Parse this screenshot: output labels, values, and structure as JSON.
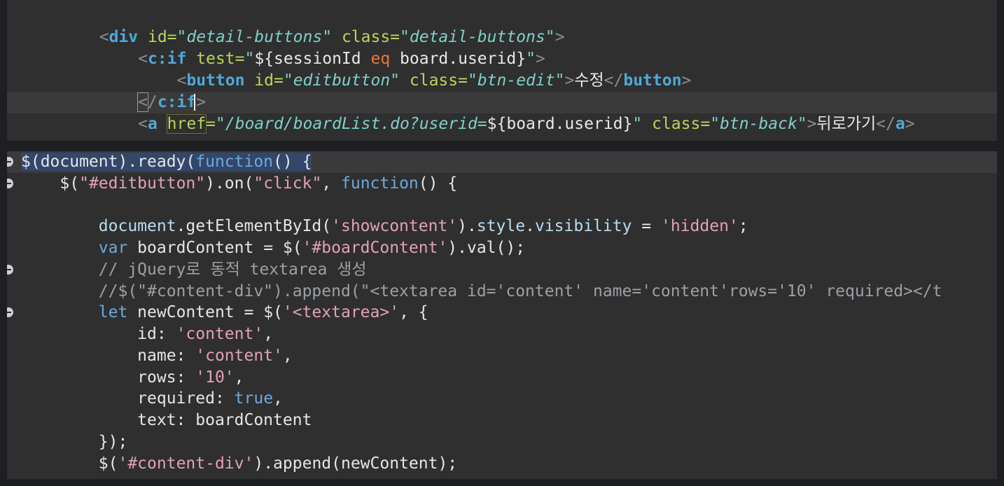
{
  "html_editor": {
    "lines": [
      [
        {
          "c": "plain",
          "t": "  "
        },
        {
          "c": "tag-punct",
          "t": "<"
        },
        {
          "c": "tag-name",
          "t": "div"
        },
        {
          "c": "plain",
          "t": " "
        },
        {
          "c": "attr-name",
          "t": "id="
        },
        {
          "c": "attr-val",
          "t": "\"detail-buttons\""
        },
        {
          "c": "plain",
          "t": " "
        },
        {
          "c": "attr-name",
          "t": "class="
        },
        {
          "c": "attr-val",
          "t": "\"detail-buttons\""
        },
        {
          "c": "tag-punct",
          "t": ">"
        }
      ],
      [
        {
          "c": "plain",
          "t": "      "
        },
        {
          "c": "tag-punct",
          "t": "<"
        },
        {
          "c": "tag-name",
          "t": "c:if"
        },
        {
          "c": "plain",
          "t": " "
        },
        {
          "c": "attr-name",
          "t": "test="
        },
        {
          "c": "attr-val",
          "t": "\""
        },
        {
          "c": "el-expr",
          "t": "${sessionId "
        },
        {
          "c": "el-op",
          "t": "eq"
        },
        {
          "c": "el-expr",
          "t": " board.userid}"
        },
        {
          "c": "attr-val",
          "t": "\""
        },
        {
          "c": "tag-punct",
          "t": ">"
        }
      ],
      [
        {
          "c": "plain",
          "t": "          "
        },
        {
          "c": "tag-punct",
          "t": "<"
        },
        {
          "c": "tag-name",
          "t": "button"
        },
        {
          "c": "plain",
          "t": " "
        },
        {
          "c": "attr-name",
          "t": "id="
        },
        {
          "c": "attr-val",
          "t": "\"editbutton\""
        },
        {
          "c": "plain",
          "t": " "
        },
        {
          "c": "attr-name",
          "t": "class="
        },
        {
          "c": "attr-val",
          "t": "\"btn-edit\""
        },
        {
          "c": "tag-punct",
          "t": ">"
        },
        {
          "c": "plain",
          "t": "수정"
        },
        {
          "c": "tag-punct",
          "t": "</"
        },
        {
          "c": "tag-name",
          "t": "button"
        },
        {
          "c": "tag-punct",
          "t": ">"
        }
      ],
      [
        {
          "c": "plain",
          "t": "      "
        },
        {
          "c": "tag-punct bracket-box",
          "t": "<"
        },
        {
          "c": "tag-punct",
          "t": "/"
        },
        {
          "c": "tag-name",
          "t": "c:if"
        },
        {
          "c": "tag-punct",
          "t": ">"
        }
      ],
      [
        {
          "c": "plain",
          "t": "      "
        },
        {
          "c": "tag-punct",
          "t": "<"
        },
        {
          "c": "tag-name",
          "t": "a"
        },
        {
          "c": "plain",
          "t": " "
        },
        {
          "c": "attr-name href-box",
          "t": "href"
        },
        {
          "c": "attr-name",
          "t": "="
        },
        {
          "c": "attr-val",
          "t": "\"/board/boardList.do?userid="
        },
        {
          "c": "el-expr",
          "t": "${board.userid}"
        },
        {
          "c": "attr-val",
          "t": "\""
        },
        {
          "c": "plain",
          "t": " "
        },
        {
          "c": "attr-name",
          "t": "class="
        },
        {
          "c": "attr-val",
          "t": "\"btn-back\""
        },
        {
          "c": "tag-punct",
          "t": ">"
        },
        {
          "c": "plain",
          "t": "뒤로가기"
        },
        {
          "c": "tag-punct",
          "t": "</"
        },
        {
          "c": "tag-name",
          "t": "a"
        },
        {
          "c": "tag-punct",
          "t": ">"
        }
      ]
    ]
  },
  "js_editor": {
    "lines": [
      [
        {
          "c": "fn sel",
          "t": "$(document).ready("
        },
        {
          "c": "kw sel",
          "t": "function"
        },
        {
          "c": "fn sel",
          "t": "() {"
        }
      ],
      [
        {
          "c": "plain",
          "t": "    "
        },
        {
          "c": "fn",
          "t": "$("
        },
        {
          "c": "str",
          "t": "\"#editbutton\""
        },
        {
          "c": "fn",
          "t": ").on("
        },
        {
          "c": "str",
          "t": "\"click\""
        },
        {
          "c": "fn",
          "t": ", "
        },
        {
          "c": "kw",
          "t": "function"
        },
        {
          "c": "fn",
          "t": "() {"
        }
      ],
      [],
      [
        {
          "c": "plain",
          "t": "        "
        },
        {
          "c": "prop",
          "t": "document"
        },
        {
          "c": "fn",
          "t": ".getElementById("
        },
        {
          "c": "str",
          "t": "'showcontent'"
        },
        {
          "c": "fn",
          "t": ")."
        },
        {
          "c": "prop",
          "t": "style"
        },
        {
          "c": "fn",
          "t": "."
        },
        {
          "c": "prop",
          "t": "visibility"
        },
        {
          "c": "fn",
          "t": " = "
        },
        {
          "c": "str",
          "t": "'hidden'"
        },
        {
          "c": "fn",
          "t": ";"
        }
      ],
      [
        {
          "c": "plain",
          "t": "        "
        },
        {
          "c": "kw",
          "t": "var"
        },
        {
          "c": "fn",
          "t": " boardContent = $("
        },
        {
          "c": "str",
          "t": "'#boardContent'"
        },
        {
          "c": "fn",
          "t": ").val();"
        }
      ],
      [
        {
          "c": "plain",
          "t": "        "
        },
        {
          "c": "cmt",
          "t": "// jQuery로 동적 textarea 생성"
        }
      ],
      [
        {
          "c": "plain",
          "t": "        "
        },
        {
          "c": "cmt",
          "t": "//$(\"#content-div\").append(\"<textarea id='content' name='content'rows='10' required></t"
        }
      ],
      [
        {
          "c": "plain",
          "t": "        "
        },
        {
          "c": "kw",
          "t": "let"
        },
        {
          "c": "fn",
          "t": " newContent = $("
        },
        {
          "c": "str",
          "t": "'<textarea>'"
        },
        {
          "c": "fn",
          "t": ", {"
        }
      ],
      [
        {
          "c": "plain",
          "t": "            "
        },
        {
          "c": "fn",
          "t": "id: "
        },
        {
          "c": "str",
          "t": "'content'"
        },
        {
          "c": "fn",
          "t": ","
        }
      ],
      [
        {
          "c": "plain",
          "t": "            "
        },
        {
          "c": "fn",
          "t": "name: "
        },
        {
          "c": "str",
          "t": "'content'"
        },
        {
          "c": "fn",
          "t": ","
        }
      ],
      [
        {
          "c": "plain",
          "t": "            "
        },
        {
          "c": "fn",
          "t": "rows: "
        },
        {
          "c": "str",
          "t": "'10'"
        },
        {
          "c": "fn",
          "t": ","
        }
      ],
      [
        {
          "c": "plain",
          "t": "            "
        },
        {
          "c": "fn",
          "t": "required: "
        },
        {
          "c": "kw",
          "t": "true"
        },
        {
          "c": "fn",
          "t": ","
        }
      ],
      [
        {
          "c": "plain",
          "t": "            "
        },
        {
          "c": "fn",
          "t": "text: boardContent"
        }
      ],
      [
        {
          "c": "plain",
          "t": "        "
        },
        {
          "c": "fn",
          "t": "});"
        }
      ],
      [
        {
          "c": "plain",
          "t": "        "
        },
        {
          "c": "fn",
          "t": "$("
        },
        {
          "c": "str",
          "t": "'#content-div'"
        },
        {
          "c": "fn",
          "t": ").append(newContent);"
        }
      ]
    ]
  }
}
